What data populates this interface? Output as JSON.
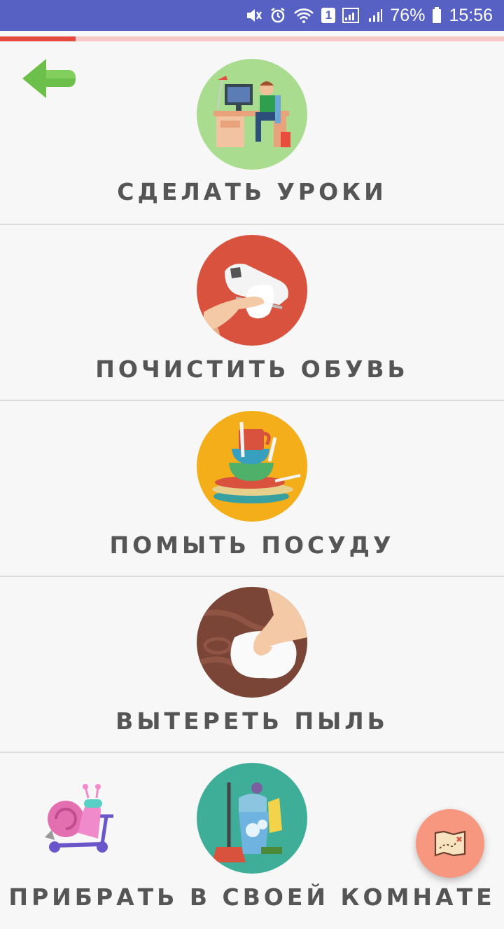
{
  "status_bar": {
    "battery_percent": "76%",
    "time": "15:56",
    "sim_badge": "1"
  },
  "progress": {
    "fraction": 0.15,
    "color": "#e4493f",
    "track": "#f6c9c7"
  },
  "back_button": {
    "icon": "arrow-left-icon",
    "color": "#6cbf4b"
  },
  "tasks": [
    {
      "label": "СДЕЛАТЬ УРОКИ",
      "icon": "homework-desk-icon",
      "bg": "#a9dc8f"
    },
    {
      "label": "ПОЧИСТИТЬ ОБУВЬ",
      "icon": "shoe-cleaning-icon",
      "bg": "#d9523e"
    },
    {
      "label": "ПОМЫТЬ ПОСУДУ",
      "icon": "dishes-icon",
      "bg": "#f3ae1a"
    },
    {
      "label": "ВЫТЕРЕТЬ ПЫЛЬ",
      "icon": "wipe-dust-icon",
      "bg": "#7a4536"
    },
    {
      "label": "ПРИБРАТЬ В СВОЕЙ КОМНАТЕ",
      "icon": "cleaning-supplies-icon",
      "bg": "#3fae98"
    }
  ],
  "mascot": {
    "icon": "snail-scooter-icon"
  },
  "fab": {
    "icon": "treasure-map-icon",
    "color": "#f7977f"
  }
}
